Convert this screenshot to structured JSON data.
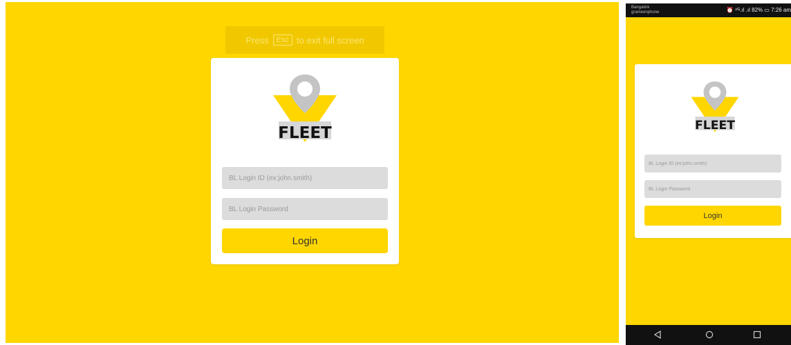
{
  "desktop": {
    "esc_hint": {
      "prefix": "Press",
      "key": "Esc",
      "suffix": "to exit full screen"
    },
    "login_form": {
      "logo_text": "FLEET",
      "login_id_placeholder": "BL Login ID (ex:john.smith)",
      "password_placeholder": "BL Login Password",
      "login_label": "Login"
    }
  },
  "mobile": {
    "status_bar": {
      "carrier_line1": "Bangalink",
      "carrier_line2": "grameenphone",
      "indicators": "⏰ ⁴ᴳ.ıl .ıl 82% ▭ 7:26 am"
    },
    "login_form": {
      "logo_text": "FLEET",
      "login_id_placeholder": "BL Login ID (ex:john.smith)",
      "password_placeholder": "BL Login Password",
      "login_label": "Login"
    },
    "nav_bar": {
      "icons": [
        "back-icon",
        "home-icon",
        "recent-apps-icon"
      ]
    }
  },
  "colors": {
    "brand_yellow": "#FFD600",
    "card_white": "#FFFFFF",
    "field_gray": "#DCDCDC",
    "pin_gray": "#C4C4C4",
    "logo_black": "#111111"
  }
}
